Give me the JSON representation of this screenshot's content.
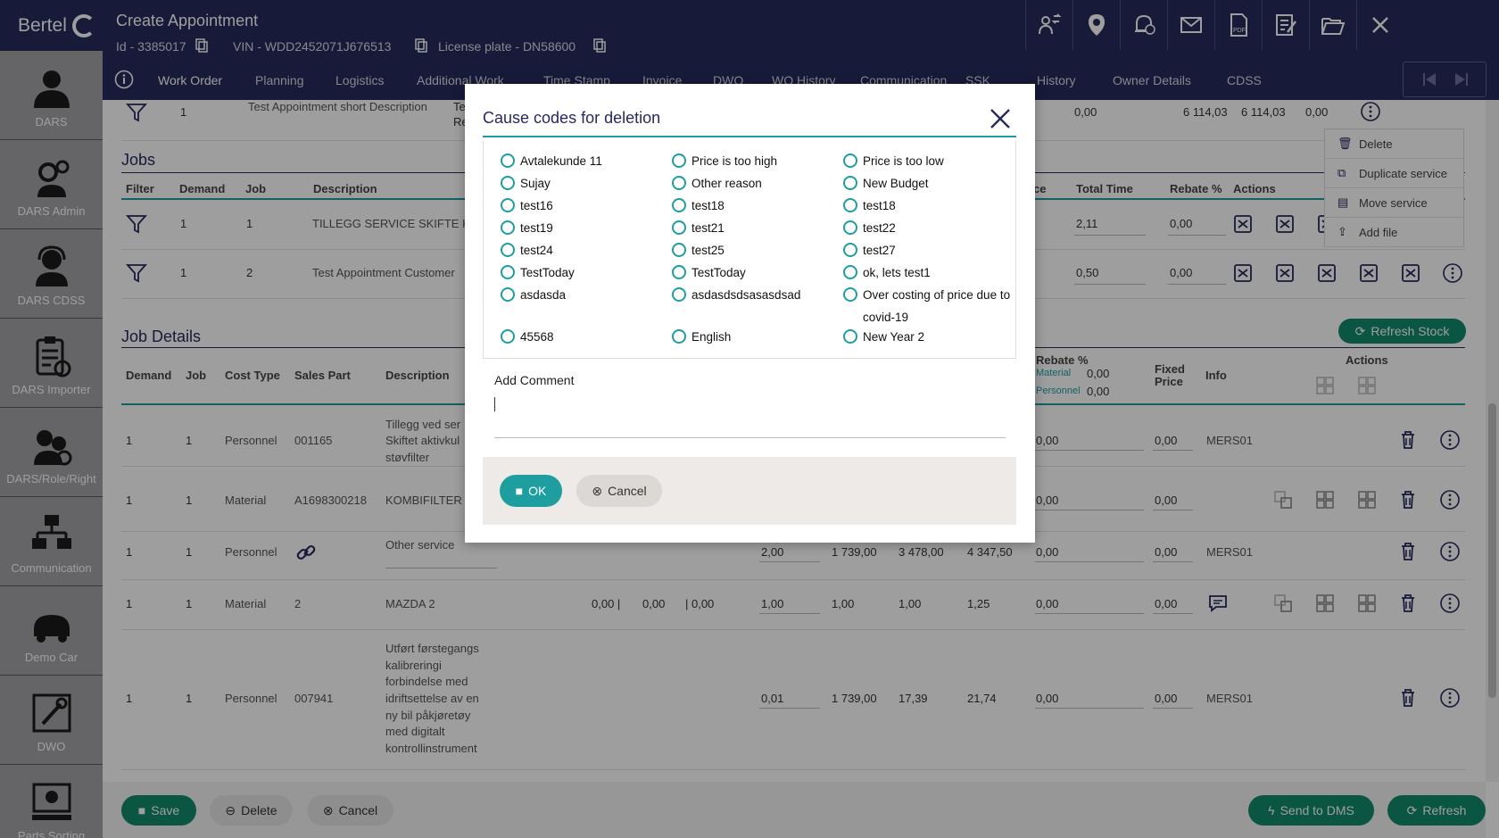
{
  "sidebar": {
    "logo": "Bertel",
    "items": [
      {
        "label": "DARS",
        "icon": "person-icon"
      },
      {
        "label": "DARS Admin",
        "icon": "gears-person-icon"
      },
      {
        "label": "DARS CDSS",
        "icon": "headset-icon"
      },
      {
        "label": "DARS Importer",
        "icon": "clipboard-icon"
      },
      {
        "label": "DARS/Role/Right",
        "icon": "group-icon"
      },
      {
        "label": "Communication",
        "icon": "network-icon"
      },
      {
        "label": "Demo Car",
        "icon": "car-icon"
      },
      {
        "label": "DWO",
        "icon": "wrench-icon"
      },
      {
        "label": "Parts Sorting",
        "icon": "parts-icon"
      }
    ]
  },
  "header": {
    "title": "Create Appointment",
    "id": "Id - 3385017",
    "vin": "VIN - WDD2452071J676513",
    "license": "License plate - DN58600"
  },
  "tabs": [
    "Work Order",
    "Planning",
    "Logistics",
    "Additional Work",
    "Time Stamp",
    "Invoice",
    "DWO",
    "WO History",
    "Communication",
    "SSK",
    "History",
    "Owner Details",
    "CDSS"
  ],
  "top_row": {
    "demand": "1",
    "description": "Test Appointment short Description",
    "col_a": "Te",
    "col_b": "Re",
    "v1": "0,00",
    "v2": "6 114,03",
    "v3": "6 114,03",
    "v4": "0,00"
  },
  "context_menu": [
    "Delete",
    "Duplicate service",
    "Move service",
    "Add file"
  ],
  "jobs": {
    "title": "Jobs",
    "headers": [
      "Filter",
      "Demand",
      "Job",
      "Description",
      "ce",
      "Total Time",
      "Rebate %",
      "Actions"
    ],
    "rows": [
      {
        "demand": "1",
        "job": "1",
        "description": "TILLEGG SERVICE SKIFTE KO",
        "total": "2,11",
        "rebate": "0,00"
      },
      {
        "demand": "1",
        "job": "2",
        "description": "Test Appointment Customer",
        "total": "0,50",
        "rebate": "0,00"
      }
    ]
  },
  "job_details": {
    "title": "Job Details",
    "refresh_stock": "Refresh Stock",
    "headers": {
      "demand": "Demand",
      "job": "Job",
      "cost_type": "Cost Type",
      "sales_part": "Sales Part",
      "description": "Description",
      "rebate": "Rebate %",
      "material": "Material",
      "personnel": "Personnel",
      "rebate_material": "0,00",
      "rebate_personnel": "0,00",
      "fixed_price": "Fixed Price",
      "info": "Info",
      "actions": "Actions"
    },
    "rows": [
      {
        "demand": "1",
        "job": "1",
        "cost_type": "Personnel",
        "sales_part": "001165",
        "description": [
          "Tillegg ved ser",
          "Skiftet aktivkul",
          "støvfilter"
        ],
        "q": "",
        "a": "",
        "b": "",
        "c": "",
        "d": "",
        "rebate": "0,00",
        "fixed": "0,00",
        "info": "MERS01"
      },
      {
        "demand": "1",
        "job": "1",
        "cost_type": "Material",
        "sales_part": "A1698300218",
        "description": [
          "KOMBIFILTER"
        ],
        "q": "",
        "a": "",
        "b": "",
        "c": "",
        "d": "",
        "rebate": "0,00",
        "fixed": "0,00",
        "info": ""
      },
      {
        "demand": "1",
        "job": "1",
        "cost_type": "Personnel",
        "sales_part": "",
        "description": [
          "Other service"
        ],
        "q": "2,00",
        "a": "1 739,00",
        "b": "3 478,00",
        "c": "4 347,50",
        "d": "",
        "rebate": "0,00",
        "fixed": "0,00",
        "info": "MERS01"
      },
      {
        "demand": "1",
        "job": "1",
        "cost_type": "Material",
        "sales_part": "2",
        "description": [
          "MAZDA 2"
        ],
        "extra": [
          "0,00 |",
          "0,00",
          "| 0,00"
        ],
        "q": "1,00",
        "a": "1,00",
        "b": "1,00",
        "c": "1,25",
        "d": "",
        "rebate": "0,00",
        "fixed": "0,00",
        "info": ""
      },
      {
        "demand": "1",
        "job": "1",
        "cost_type": "Personnel",
        "sales_part": "007941",
        "description": [
          "Utført førstegangs",
          "kalibreringi",
          "forbindelse med",
          "idriftsettelse av en",
          "ny bil påkjøretøy",
          "med digitalt",
          "kontrollinstrument"
        ],
        "q": "0,01",
        "a": "1 739,00",
        "b": "17,39",
        "c": "21,74",
        "d": "",
        "rebate": "0,00",
        "fixed": "0,00",
        "info": "MERS01"
      }
    ]
  },
  "footer": {
    "save": "Save",
    "delete": "Delete",
    "cancel": "Cancel",
    "send_dms": "Send to DMS",
    "refresh": "Refresh"
  },
  "modal": {
    "title": "Cause codes for deletion",
    "options": [
      [
        "Avtalekunde 11",
        "Price is too high",
        "Price is too low"
      ],
      [
        "Sujay",
        "Other reason",
        "New Budget"
      ],
      [
        "test16",
        "test18",
        "test18"
      ],
      [
        "test19",
        "test21",
        "test22"
      ],
      [
        "test24",
        "test25",
        "test27"
      ],
      [
        "TestToday",
        "TestToday",
        "ok, lets test1"
      ],
      [
        "asdasda",
        "asdasdsdsasasdsad",
        "Over costing of price due to covid-19"
      ],
      [
        "45568",
        "English",
        "New Year 2"
      ]
    ],
    "comment_label": "Add Comment",
    "comment_value": "",
    "ok": "OK",
    "cancel": "Cancel"
  },
  "colors": {
    "navy": "#262a5c",
    "teal": "#1e9e9e",
    "green": "#138a6c"
  }
}
